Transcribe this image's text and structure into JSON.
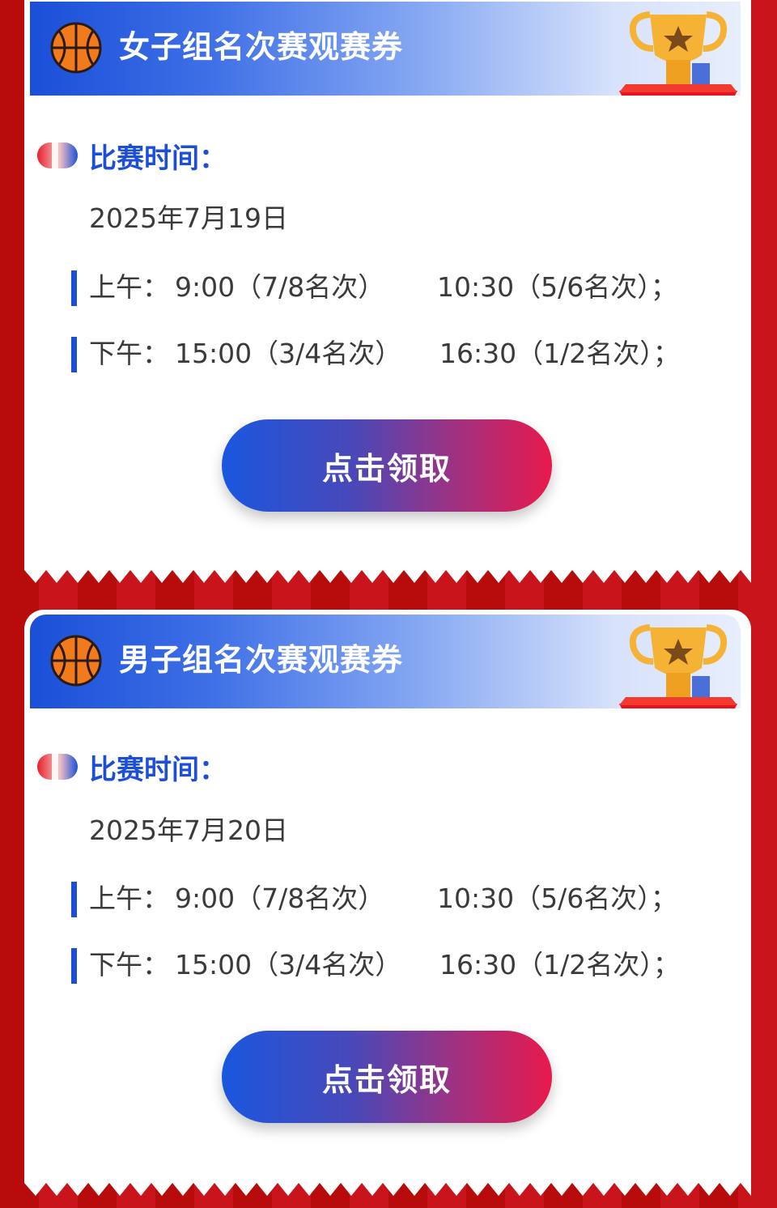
{
  "colors": {
    "background_red": "#b80b0c",
    "accent_blue": "#1d4fd6",
    "button_start": "#1a57df",
    "button_end": "#e8194d"
  },
  "tickets": [
    {
      "title": "女子组名次赛观赛券",
      "section_label": "比赛时间：",
      "date": "2025年7月19日",
      "morning": {
        "label": "上午：",
        "slot_a": "9:00（7/8名次）",
        "slot_b": "10:30（5/6名次）；"
      },
      "afternoon": {
        "label": "下午：",
        "slot_a": "15:00（3/4名次）",
        "slot_b": "16:30（1/2名次）；"
      },
      "button": "点击领取",
      "icons": [
        "basketball-icon",
        "trophy-icon",
        "pill-icon"
      ]
    },
    {
      "title": "男子组名次赛观赛券",
      "section_label": "比赛时间：",
      "date": "2025年7月20日",
      "morning": {
        "label": "上午：",
        "slot_a": "9:00（7/8名次）",
        "slot_b": "10:30（5/6名次）；"
      },
      "afternoon": {
        "label": "下午：",
        "slot_a": "15:00（3/4名次）",
        "slot_b": "16:30（1/2名次）；"
      },
      "button": "点击领取",
      "icons": [
        "basketball-icon",
        "trophy-icon",
        "pill-icon"
      ]
    }
  ]
}
